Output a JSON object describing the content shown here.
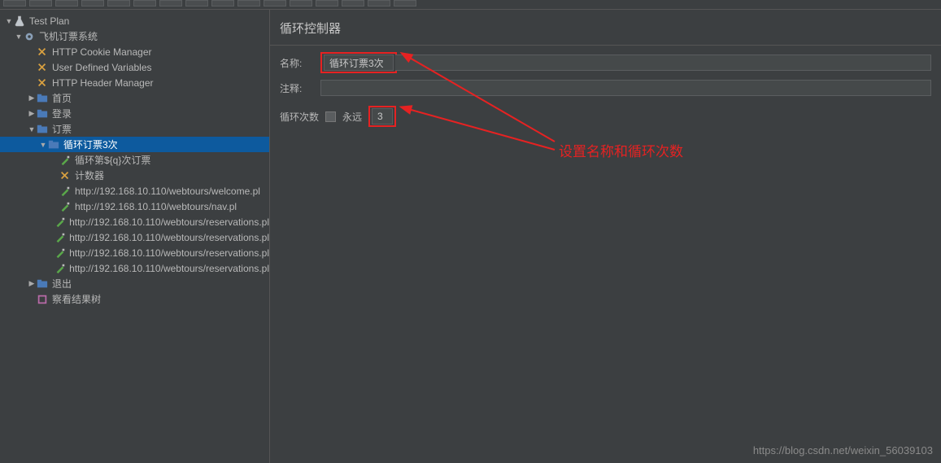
{
  "toolbar": {
    "buttons": 16
  },
  "tree": {
    "root": "Test Plan",
    "items": [
      {
        "label": "Test Plan",
        "indent": 0,
        "arrow": "▼",
        "icon": "flask"
      },
      {
        "label": "飞机订票系统",
        "indent": 1,
        "arrow": "▼",
        "icon": "gear"
      },
      {
        "label": "HTTP Cookie Manager",
        "indent": 2,
        "arrow": "",
        "icon": "config"
      },
      {
        "label": "User Defined Variables",
        "indent": 2,
        "arrow": "",
        "icon": "config"
      },
      {
        "label": "HTTP Header Manager",
        "indent": 2,
        "arrow": "",
        "icon": "config"
      },
      {
        "label": "首页",
        "indent": 2,
        "arrow": "▶",
        "icon": "folder"
      },
      {
        "label": "登录",
        "indent": 2,
        "arrow": "▶",
        "icon": "folder"
      },
      {
        "label": "订票",
        "indent": 2,
        "arrow": "▼",
        "icon": "folder"
      },
      {
        "label": "循环订票3次",
        "indent": 3,
        "arrow": "▼",
        "icon": "folder",
        "selected": true
      },
      {
        "label": "循环第${q}次订票",
        "indent": 4,
        "arrow": "",
        "icon": "sampler"
      },
      {
        "label": "计数器",
        "indent": 4,
        "arrow": "",
        "icon": "config"
      },
      {
        "label": "http://192.168.10.110/webtours/welcome.pl",
        "indent": 4,
        "arrow": "",
        "icon": "sampler"
      },
      {
        "label": "http://192.168.10.110/webtours/nav.pl",
        "indent": 4,
        "arrow": "",
        "icon": "sampler"
      },
      {
        "label": "http://192.168.10.110/webtours/reservations.pl",
        "indent": 4,
        "arrow": "",
        "icon": "sampler"
      },
      {
        "label": "http://192.168.10.110/webtours/reservations.pl",
        "indent": 4,
        "arrow": "",
        "icon": "sampler"
      },
      {
        "label": "http://192.168.10.110/webtours/reservations.pl",
        "indent": 4,
        "arrow": "",
        "icon": "sampler"
      },
      {
        "label": "http://192.168.10.110/webtours/reservations.pl",
        "indent": 4,
        "arrow": "",
        "icon": "sampler"
      },
      {
        "label": "退出",
        "indent": 2,
        "arrow": "▶",
        "icon": "folder"
      },
      {
        "label": "察看结果树",
        "indent": 2,
        "arrow": "",
        "icon": "listener"
      }
    ]
  },
  "panel": {
    "title": "循环控制器",
    "name_label": "名称:",
    "name_value": "循环订票3次",
    "comment_label": "注释:",
    "comment_value": "",
    "loop_label": "循环次数",
    "forever_label": "永远",
    "loop_value": "3"
  },
  "annotation": {
    "text": "设置名称和循环次数"
  },
  "watermark": "https://blog.csdn.net/weixin_56039103",
  "colors": {
    "red": "#e62222",
    "bg": "#3c3f41",
    "selected": "#0d5a9e"
  }
}
